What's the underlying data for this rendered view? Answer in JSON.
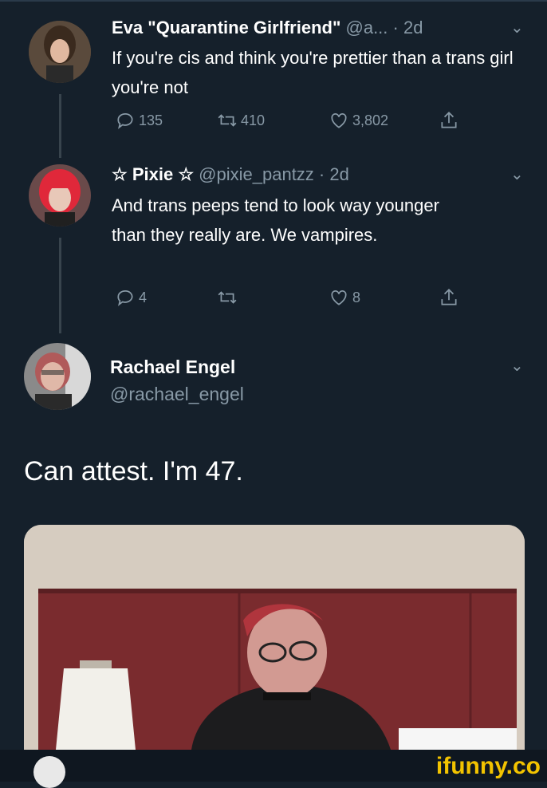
{
  "tweets": [
    {
      "name": "Eva \"Quarantine Girlfriend\"",
      "handle": "@a...",
      "time": "· 2d",
      "text": "If you're cis and think you're prettier than a trans girl you're not",
      "replies": "135",
      "retweets": "410",
      "likes": "3,802"
    },
    {
      "name": "☆ Pixie ☆",
      "handle": "@pixie_pantzz · 2d",
      "text": "And trans peeps tend to look way younger than they really are. We vampires.",
      "replies": "4",
      "retweets": "",
      "likes": "8"
    }
  ],
  "main": {
    "name": "Rachael Engel",
    "handle": "@rachael_engel",
    "text": "Can attest. I'm 47."
  },
  "watermark": "ifunny.co",
  "colors": {
    "background": "#15202b",
    "secondary_text": "#8899a6",
    "watermark": "#f2c300"
  }
}
